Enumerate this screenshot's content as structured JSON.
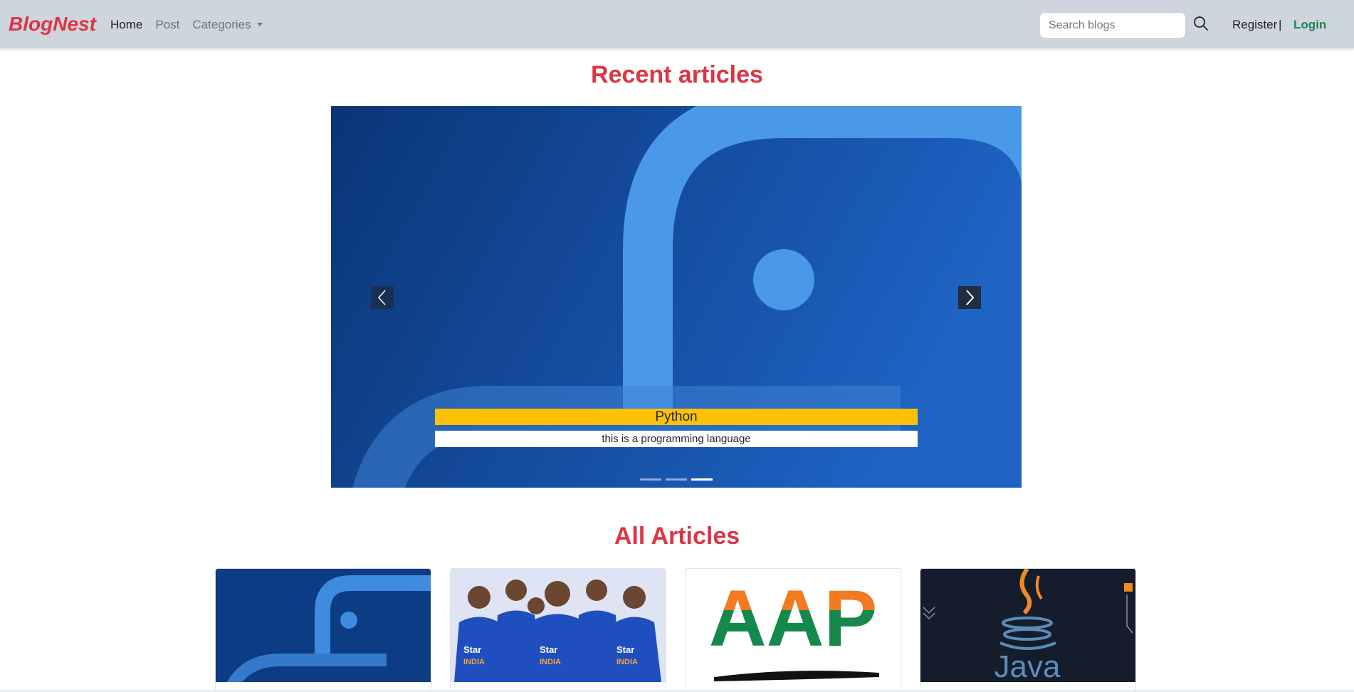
{
  "brand": "BlogNest",
  "nav": {
    "home": "Home",
    "post": "Post",
    "categories": "Categories"
  },
  "search": {
    "placeholder": "Search blogs"
  },
  "auth": {
    "register": "Register",
    "separator": "|",
    "login": "Login"
  },
  "recent": {
    "title": "Recent articles",
    "slide": {
      "title": "Python",
      "caption": "this is a programming language"
    },
    "indicator_count": 3,
    "active_indicator": 3
  },
  "all": {
    "title": "All Articles",
    "cards": [
      {
        "image": "python-logo"
      },
      {
        "image": "india-cricket-team"
      },
      {
        "image": "aap-logo",
        "image_text": "AAP"
      },
      {
        "image": "java-logo",
        "image_text": "Java"
      }
    ]
  },
  "colors": {
    "accent": "#dc3545",
    "login": "#198754",
    "caption": "#ffc107",
    "navbar": "#cfd5dc"
  }
}
